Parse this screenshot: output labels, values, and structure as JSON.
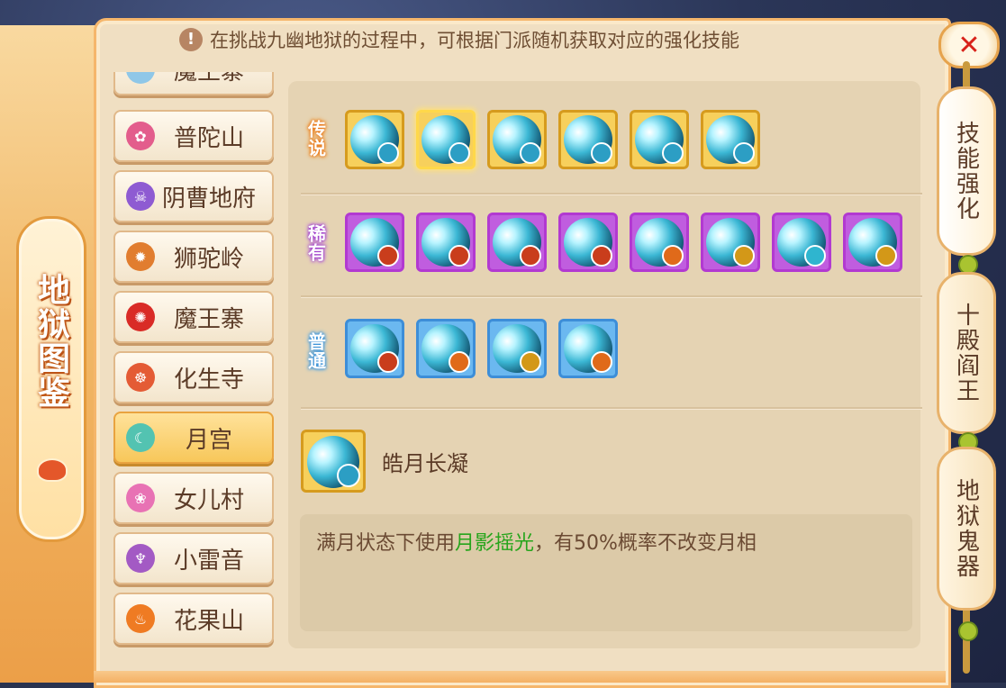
{
  "left_banner": {
    "title": "地狱图鉴"
  },
  "close_button": {
    "label": "✕"
  },
  "hint": {
    "text": "在挑战九幽地狱的过程中，可根据门派随机获取对应的强化技能",
    "icon": "!"
  },
  "sects": [
    {
      "label": "魔王寨",
      "partial_top": true,
      "icon_color": "#8fc7e8"
    },
    {
      "label": "普陀山",
      "icon_color": "#e35d8c"
    },
    {
      "label": "阴曹地府",
      "icon_color": "#8e5bd2"
    },
    {
      "label": "狮驼岭",
      "icon_color": "#e17d2f"
    },
    {
      "label": "魔王寨",
      "icon_color": "#d92b26"
    },
    {
      "label": "化生寺",
      "icon_color": "#e45b35"
    },
    {
      "label": "月宫",
      "icon_color": "#53c3b1",
      "active": true
    },
    {
      "label": "女儿村",
      "icon_color": "#e872b4"
    },
    {
      "label": "小雷音",
      "icon_color": "#a35ac4"
    },
    {
      "label": "花果山",
      "icon_color": "#ef7b23"
    }
  ],
  "tiers": {
    "legend": {
      "label": "传说",
      "skills": [
        {
          "badge": "b-cyan",
          "selected": false
        },
        {
          "badge": "b-cyan",
          "selected": true
        },
        {
          "badge": "b-cyan",
          "selected": false
        },
        {
          "badge": "b-cyan",
          "selected": false
        },
        {
          "badge": "b-cyan",
          "selected": false
        },
        {
          "badge": "b-cyan",
          "selected": false
        }
      ]
    },
    "rare": {
      "label": "稀有",
      "skills": [
        {
          "badge": "b-red"
        },
        {
          "badge": "b-red"
        },
        {
          "badge": "b-red"
        },
        {
          "badge": "b-red"
        },
        {
          "badge": "b-orange"
        },
        {
          "badge": "b-gold"
        },
        {
          "badge": "b-sky"
        },
        {
          "badge": "b-gold"
        }
      ]
    },
    "common": {
      "label": "普通",
      "skills": [
        {
          "badge": "b-red"
        },
        {
          "badge": "b-orange"
        },
        {
          "badge": "b-gold"
        },
        {
          "badge": "b-orange"
        }
      ]
    }
  },
  "detail": {
    "name": "皓月长凝",
    "desc_before": "满月状态下使用",
    "desc_highlight": "月影摇光",
    "desc_after": "，有50%概率不改变月相"
  },
  "side_tabs": [
    {
      "label": "技能强化",
      "active": true
    },
    {
      "label": "十殿阎王",
      "active": false
    },
    {
      "label": "地狱鬼器",
      "active": false
    }
  ]
}
